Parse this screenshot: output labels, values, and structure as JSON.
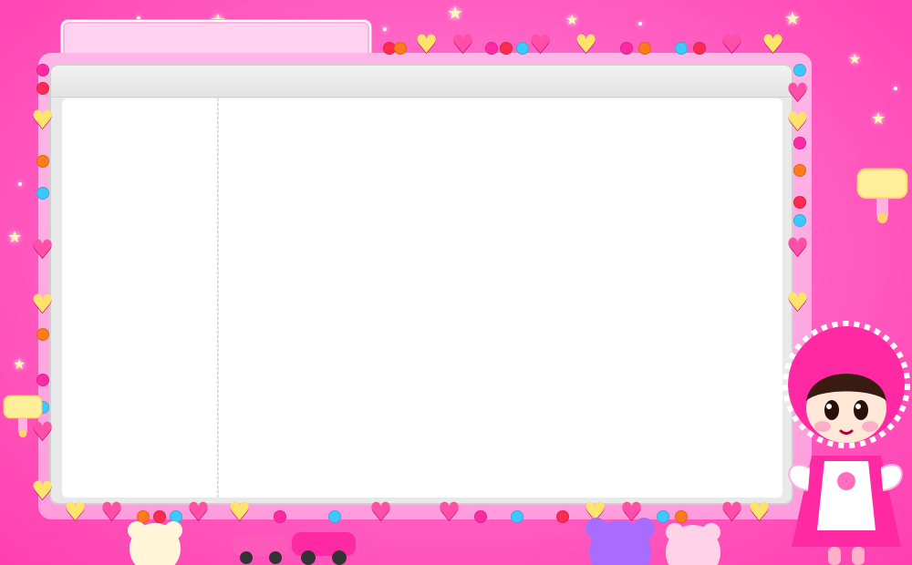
{
  "window": {
    "title_text": ""
  },
  "colors": {
    "background": "#ff5fc2",
    "frame": "#ff9ddc",
    "panel": "#e9e9e9",
    "pane": "#ffffff",
    "accent": "#ff2aa3"
  },
  "icons": {
    "sparkle": "sparkle-icon",
    "heart": "heart-icon",
    "bead": "bead-icon",
    "character": "girl-character-icon",
    "lamp": "lamp-icon",
    "car": "toy-car-icon",
    "bear": "teddy-bear-icon"
  }
}
